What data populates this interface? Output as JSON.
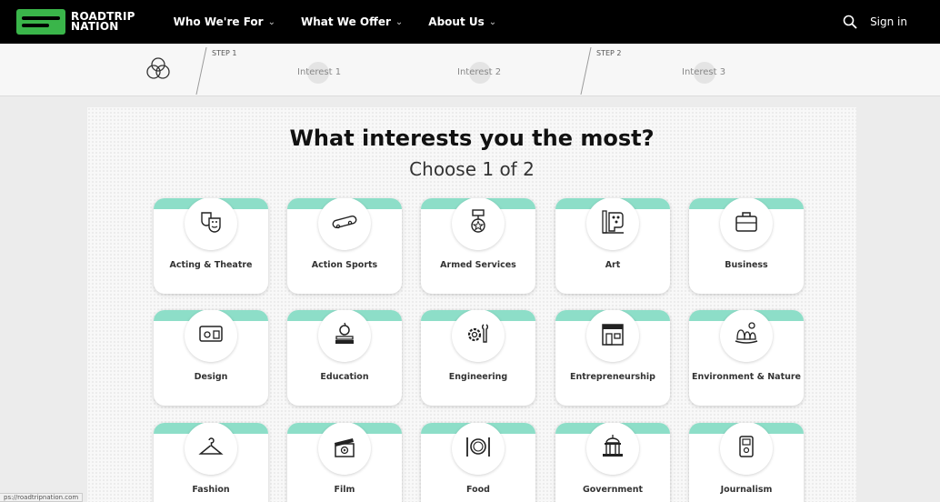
{
  "nav": {
    "logo_line1": "ROADTRIP",
    "logo_line2": "NATION",
    "items": [
      {
        "label": "Who We're For",
        "chevron": "⌄"
      },
      {
        "label": "What We Offer",
        "chevron": "⌄"
      },
      {
        "label": "About Us",
        "chevron": "⌄"
      }
    ],
    "signin": "Sign in",
    "search_icon": "search-icon"
  },
  "steps": {
    "step1": "STEP 1",
    "step2": "STEP 2",
    "interests": [
      "Interest 1",
      "Interest 2",
      "Interest 3"
    ]
  },
  "main": {
    "title": "What interests you the most?",
    "subtitle": "Choose 1 of 2",
    "accent_color": "#8ddec8",
    "cards": [
      {
        "label": "Acting & Theatre",
        "icon": "theatre-masks-icon"
      },
      {
        "label": "Action Sports",
        "icon": "skateboard-icon"
      },
      {
        "label": "Armed Services",
        "icon": "medal-icon"
      },
      {
        "label": "Art",
        "icon": "palette-icon"
      },
      {
        "label": "Business",
        "icon": "briefcase-icon"
      },
      {
        "label": "Design",
        "icon": "design-tools-icon"
      },
      {
        "label": "Education",
        "icon": "apple-books-icon"
      },
      {
        "label": "Engineering",
        "icon": "gear-wrench-icon"
      },
      {
        "label": "Entrepreneurship",
        "icon": "storefront-icon"
      },
      {
        "label": "Environment & Nature",
        "icon": "landscape-icon"
      },
      {
        "label": "Fashion",
        "icon": "hanger-icon"
      },
      {
        "label": "Film",
        "icon": "clapperboard-icon"
      },
      {
        "label": "Food",
        "icon": "plate-cutlery-icon"
      },
      {
        "label": "Government",
        "icon": "capitol-icon"
      },
      {
        "label": "Journalism",
        "icon": "recorder-icon"
      }
    ]
  },
  "status": {
    "url": "ps://roadtripnation.com"
  }
}
